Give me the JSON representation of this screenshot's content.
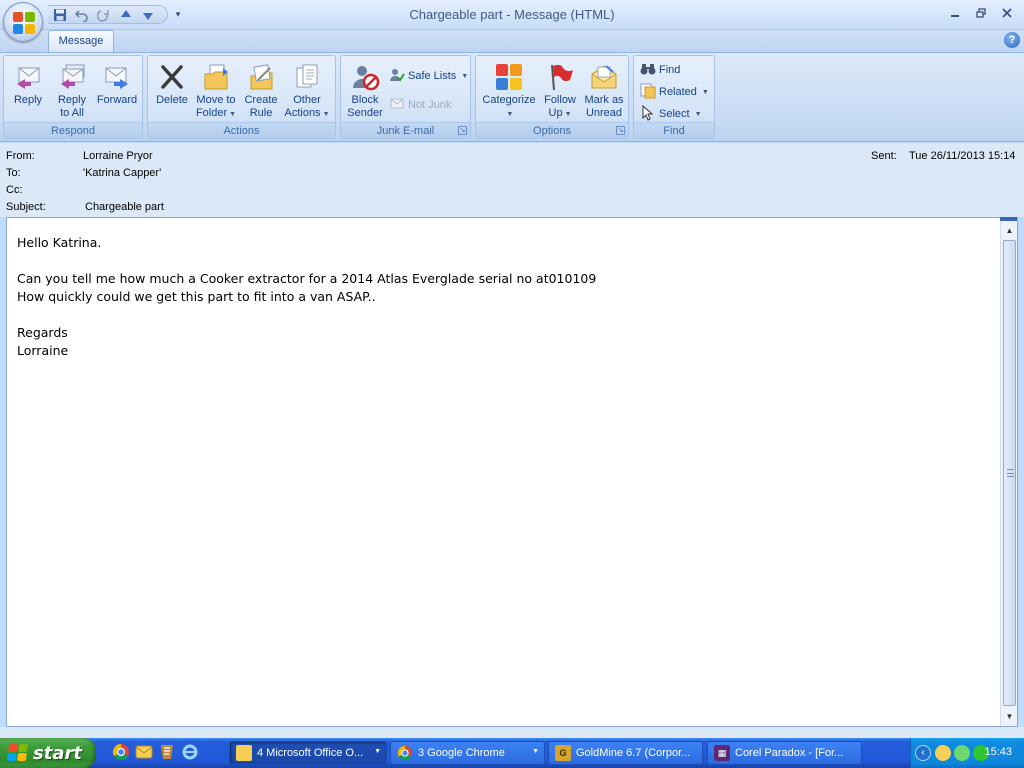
{
  "window": {
    "title": "Chargeable part - Message (HTML)"
  },
  "ribbon": {
    "tab": "Message",
    "groups": {
      "respond": "Respond",
      "actions": "Actions",
      "junk": "Junk E-mail",
      "options": "Options",
      "find": "Find"
    },
    "buttons": {
      "reply": "Reply",
      "reply_all_1": "Reply",
      "reply_all_2": "to All",
      "forward": "Forward",
      "delete": "Delete",
      "move_1": "Move to",
      "move_2": "Folder",
      "create_1": "Create",
      "create_2": "Rule",
      "other_1": "Other",
      "other_2": "Actions",
      "block_1": "Block",
      "block_2": "Sender",
      "safe_lists": "Safe Lists",
      "not_junk": "Not Junk",
      "categorize": "Categorize",
      "follow_1": "Follow",
      "follow_2": "Up",
      "mark_1": "Mark as",
      "mark_2": "Unread",
      "find": "Find",
      "related": "Related",
      "select": "Select"
    }
  },
  "header": {
    "from_label": "From:",
    "from": "Lorraine Pryor",
    "to_label": "To:",
    "to": "'Katrina Capper'",
    "cc_label": "Cc:",
    "cc": "",
    "subject_label": "Subject:",
    "subject": "Chargeable part",
    "sent_label": "Sent:",
    "sent": "Tue 26/11/2013 15:14"
  },
  "body": {
    "lines": [
      "Hello Katrina.",
      "",
      "Can you tell me how much a Cooker extractor for a 2014 Atlas Everglade serial no at010109",
      "How quickly could we get this part to fit into a van ASAP..",
      "",
      "Regards",
      "Lorraine"
    ]
  },
  "taskbar": {
    "start": "start",
    "items": [
      "4 Microsoft Office O...",
      "3 Google Chrome",
      "GoldMine 6.7 (Corpor...",
      "Corel Paradox - [For..."
    ],
    "clock": "15:43"
  }
}
